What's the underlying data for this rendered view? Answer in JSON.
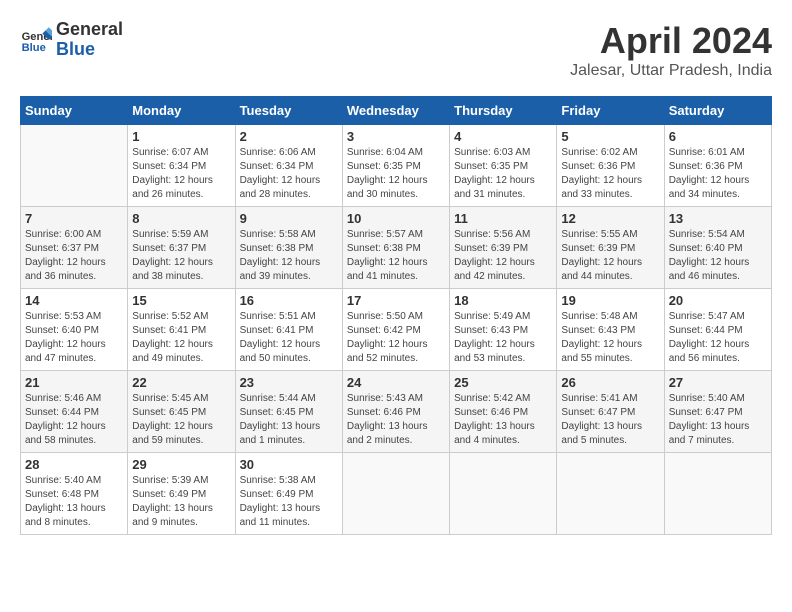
{
  "header": {
    "logo_line1": "General",
    "logo_line2": "Blue",
    "title": "April 2024",
    "location": "Jalesar, Uttar Pradesh, India"
  },
  "days_of_week": [
    "Sunday",
    "Monday",
    "Tuesday",
    "Wednesday",
    "Thursday",
    "Friday",
    "Saturday"
  ],
  "weeks": [
    [
      {
        "day": "",
        "info": ""
      },
      {
        "day": "1",
        "info": "Sunrise: 6:07 AM\nSunset: 6:34 PM\nDaylight: 12 hours\nand 26 minutes."
      },
      {
        "day": "2",
        "info": "Sunrise: 6:06 AM\nSunset: 6:34 PM\nDaylight: 12 hours\nand 28 minutes."
      },
      {
        "day": "3",
        "info": "Sunrise: 6:04 AM\nSunset: 6:35 PM\nDaylight: 12 hours\nand 30 minutes."
      },
      {
        "day": "4",
        "info": "Sunrise: 6:03 AM\nSunset: 6:35 PM\nDaylight: 12 hours\nand 31 minutes."
      },
      {
        "day": "5",
        "info": "Sunrise: 6:02 AM\nSunset: 6:36 PM\nDaylight: 12 hours\nand 33 minutes."
      },
      {
        "day": "6",
        "info": "Sunrise: 6:01 AM\nSunset: 6:36 PM\nDaylight: 12 hours\nand 34 minutes."
      }
    ],
    [
      {
        "day": "7",
        "info": "Sunrise: 6:00 AM\nSunset: 6:37 PM\nDaylight: 12 hours\nand 36 minutes."
      },
      {
        "day": "8",
        "info": "Sunrise: 5:59 AM\nSunset: 6:37 PM\nDaylight: 12 hours\nand 38 minutes."
      },
      {
        "day": "9",
        "info": "Sunrise: 5:58 AM\nSunset: 6:38 PM\nDaylight: 12 hours\nand 39 minutes."
      },
      {
        "day": "10",
        "info": "Sunrise: 5:57 AM\nSunset: 6:38 PM\nDaylight: 12 hours\nand 41 minutes."
      },
      {
        "day": "11",
        "info": "Sunrise: 5:56 AM\nSunset: 6:39 PM\nDaylight: 12 hours\nand 42 minutes."
      },
      {
        "day": "12",
        "info": "Sunrise: 5:55 AM\nSunset: 6:39 PM\nDaylight: 12 hours\nand 44 minutes."
      },
      {
        "day": "13",
        "info": "Sunrise: 5:54 AM\nSunset: 6:40 PM\nDaylight: 12 hours\nand 46 minutes."
      }
    ],
    [
      {
        "day": "14",
        "info": "Sunrise: 5:53 AM\nSunset: 6:40 PM\nDaylight: 12 hours\nand 47 minutes."
      },
      {
        "day": "15",
        "info": "Sunrise: 5:52 AM\nSunset: 6:41 PM\nDaylight: 12 hours\nand 49 minutes."
      },
      {
        "day": "16",
        "info": "Sunrise: 5:51 AM\nSunset: 6:41 PM\nDaylight: 12 hours\nand 50 minutes."
      },
      {
        "day": "17",
        "info": "Sunrise: 5:50 AM\nSunset: 6:42 PM\nDaylight: 12 hours\nand 52 minutes."
      },
      {
        "day": "18",
        "info": "Sunrise: 5:49 AM\nSunset: 6:43 PM\nDaylight: 12 hours\nand 53 minutes."
      },
      {
        "day": "19",
        "info": "Sunrise: 5:48 AM\nSunset: 6:43 PM\nDaylight: 12 hours\nand 55 minutes."
      },
      {
        "day": "20",
        "info": "Sunrise: 5:47 AM\nSunset: 6:44 PM\nDaylight: 12 hours\nand 56 minutes."
      }
    ],
    [
      {
        "day": "21",
        "info": "Sunrise: 5:46 AM\nSunset: 6:44 PM\nDaylight: 12 hours\nand 58 minutes."
      },
      {
        "day": "22",
        "info": "Sunrise: 5:45 AM\nSunset: 6:45 PM\nDaylight: 12 hours\nand 59 minutes."
      },
      {
        "day": "23",
        "info": "Sunrise: 5:44 AM\nSunset: 6:45 PM\nDaylight: 13 hours\nand 1 minutes."
      },
      {
        "day": "24",
        "info": "Sunrise: 5:43 AM\nSunset: 6:46 PM\nDaylight: 13 hours\nand 2 minutes."
      },
      {
        "day": "25",
        "info": "Sunrise: 5:42 AM\nSunset: 6:46 PM\nDaylight: 13 hours\nand 4 minutes."
      },
      {
        "day": "26",
        "info": "Sunrise: 5:41 AM\nSunset: 6:47 PM\nDaylight: 13 hours\nand 5 minutes."
      },
      {
        "day": "27",
        "info": "Sunrise: 5:40 AM\nSunset: 6:47 PM\nDaylight: 13 hours\nand 7 minutes."
      }
    ],
    [
      {
        "day": "28",
        "info": "Sunrise: 5:40 AM\nSunset: 6:48 PM\nDaylight: 13 hours\nand 8 minutes."
      },
      {
        "day": "29",
        "info": "Sunrise: 5:39 AM\nSunset: 6:49 PM\nDaylight: 13 hours\nand 9 minutes."
      },
      {
        "day": "30",
        "info": "Sunrise: 5:38 AM\nSunset: 6:49 PM\nDaylight: 13 hours\nand 11 minutes."
      },
      {
        "day": "",
        "info": ""
      },
      {
        "day": "",
        "info": ""
      },
      {
        "day": "",
        "info": ""
      },
      {
        "day": "",
        "info": ""
      }
    ]
  ]
}
